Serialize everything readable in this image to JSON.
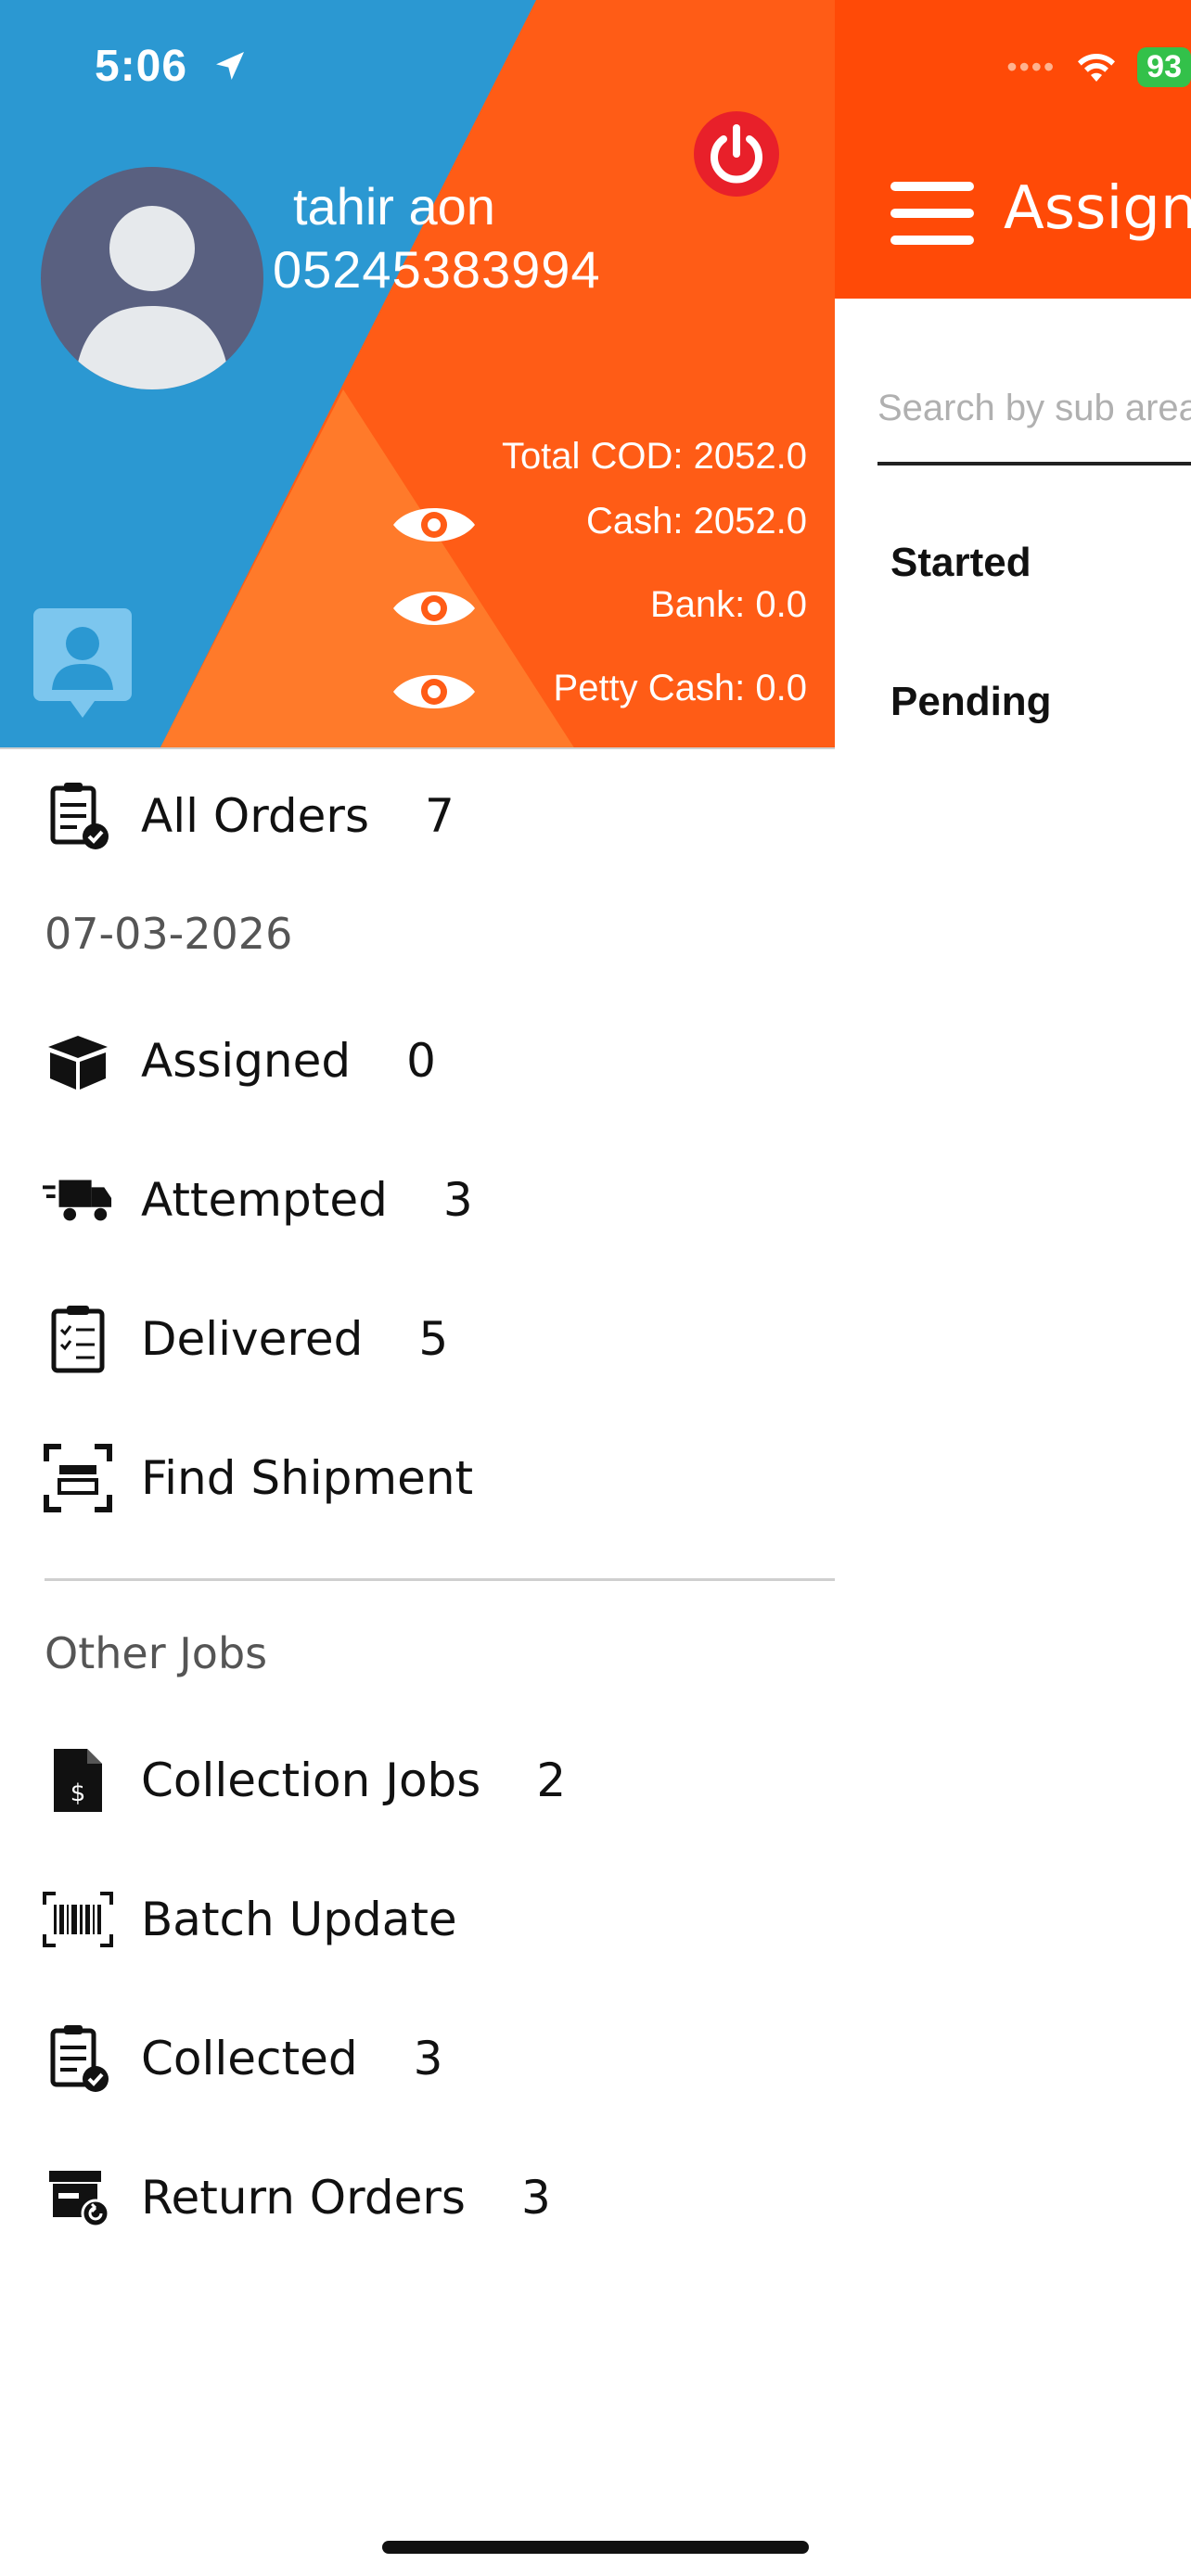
{
  "status": {
    "time": "5:06",
    "battery": "93"
  },
  "background_screen": {
    "title": "Assigned",
    "search_placeholder": "Search by sub area",
    "items": [
      "Started",
      "Pending"
    ]
  },
  "drawer": {
    "user": {
      "name": "tahir aon",
      "phone": "05245383994"
    },
    "balances": {
      "total_cod": "Total COD: 2052.0",
      "cash": "Cash: 2052.0",
      "bank": "Bank: 0.0",
      "petty_cash": "Petty Cash: 0.0"
    },
    "all_orders": {
      "label": "All Orders",
      "count": "7"
    },
    "date": "07-03-2026",
    "menu": [
      {
        "label": "Assigned",
        "count": "0",
        "icon": "box-icon"
      },
      {
        "label": "Attempted",
        "count": "3",
        "icon": "truck-icon"
      },
      {
        "label": "Delivered",
        "count": "5",
        "icon": "checklist-icon"
      },
      {
        "label": "Find Shipment",
        "count": "",
        "icon": "scan-icon"
      }
    ],
    "other_jobs_label": "Other Jobs",
    "other_jobs": [
      {
        "label": "Collection Jobs",
        "count": "2",
        "icon": "dollar-document-icon"
      },
      {
        "label": "Batch Update",
        "count": "",
        "icon": "barcode-icon"
      },
      {
        "label": "Collected",
        "count": "3",
        "icon": "clipboard-check-icon"
      },
      {
        "label": "Return Orders",
        "count": "3",
        "icon": "return-box-icon"
      }
    ]
  },
  "colors": {
    "orange": "#ff4a07",
    "blue": "#2b98d2",
    "red": "#e8202a",
    "green": "#33c14a"
  }
}
